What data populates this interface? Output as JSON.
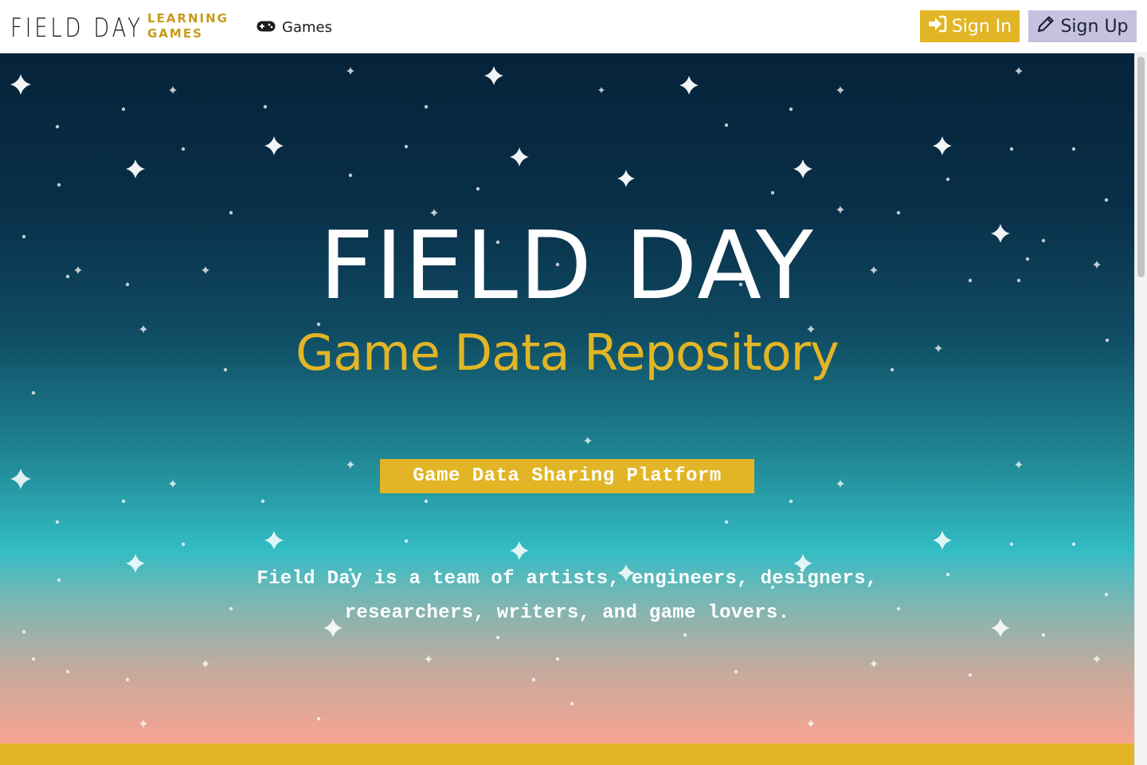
{
  "nav": {
    "logo_main": "FIELD DAY",
    "logo_sub_line1": "LEARNING",
    "logo_sub_line2": "GAMES",
    "games_label": "Games",
    "games_icon": "gamepad-icon",
    "sign_in_label": "Sign In",
    "sign_in_icon": "sign-in-icon",
    "sign_up_label": "Sign Up",
    "sign_up_icon": "pencil-icon"
  },
  "hero": {
    "title": "FIELD DAY",
    "subtitle": "Game Data Repository",
    "badge": "Game Data Sharing Platform",
    "tagline_line1": "Field Day is a team of artists, engineers, designers,",
    "tagline_line2": "researchers, writers, and game lovers."
  },
  "colors": {
    "accent_gold": "#e1b525",
    "logo_gold": "#c79a1a",
    "sign_up_bg": "#c5c2de",
    "sky_top": "#05233a",
    "sky_mid": "#33bcc4",
    "sky_bottom": "#f8a392"
  }
}
